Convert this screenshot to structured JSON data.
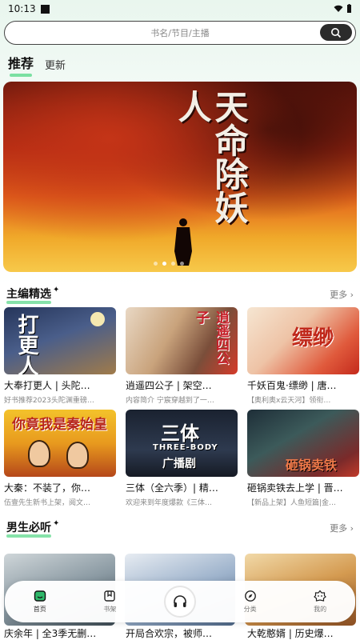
{
  "status": {
    "time": "10:13"
  },
  "search": {
    "placeholder": "书名/节目/主播"
  },
  "tabs": [
    {
      "label": "推荐"
    },
    {
      "label": "更新"
    }
  ],
  "banner": {
    "title": "天命除妖人"
  },
  "sections": [
    {
      "title": "主编精选",
      "more": "更多",
      "items": [
        {
          "title": "大奉打更人 | 头陀…",
          "desc": "好书推荐2023头陀渊重磅…",
          "cover_text": "打更人"
        },
        {
          "title": "逍遥四公子 | 架空…",
          "desc": "内容简介 宁宸穿越到了一…",
          "cover_text": "逍遥四公子"
        },
        {
          "title": "千妖百鬼·缥缈 | 唐…",
          "desc": "【奥利奥x云天河】领衔…",
          "cover_text": "缥缈"
        },
        {
          "title": "大秦：不装了，你…",
          "desc": "伍壹先生新书上架，阅文…",
          "cover_text": "你竟我是秦始皇"
        },
        {
          "title": "三体（全六季）| 精…",
          "desc": "欢迎来到年度爆款《三体…",
          "cover_text": "三体",
          "cover_sub": "THREE-BODY",
          "cover_sub2": "广播剧"
        },
        {
          "title": "砸锅卖铁去上学 | 晋…",
          "desc": "【新品上架】人鱼短篇|金…",
          "cover_text": "砸锅卖铁"
        }
      ]
    },
    {
      "title": "男生必听",
      "more": "更多",
      "items": [
        {
          "title": "庆余年 | 全3季无删…"
        },
        {
          "title": "开局合欢宗，被师…"
        },
        {
          "title": "大乾憨婿 | 历史爆…"
        }
      ]
    }
  ],
  "nav": [
    {
      "label": "首页"
    },
    {
      "label": "书架"
    },
    {
      "label": ""
    },
    {
      "label": "分类"
    },
    {
      "label": "我的"
    }
  ]
}
